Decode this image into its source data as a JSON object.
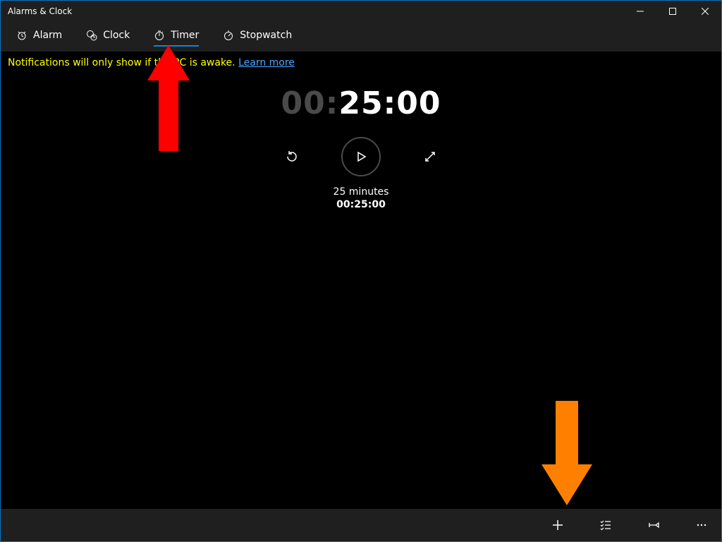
{
  "window": {
    "title": "Alarms & Clock"
  },
  "tabs": [
    {
      "label": "Alarm"
    },
    {
      "label": "Clock"
    },
    {
      "label": "Timer"
    },
    {
      "label": "Stopwatch"
    }
  ],
  "notice": {
    "text": "Notifications will only show if the PC is awake.",
    "link": "Learn more"
  },
  "timer": {
    "display": {
      "dim_prefix": "00",
      "dim_colon": ":",
      "bright": "25:00"
    },
    "name": "25 minutes",
    "remaining": "00:25:00"
  },
  "commands": {
    "add": "+",
    "select": "select",
    "pin": "pin",
    "more": "more"
  },
  "annotations": {
    "arrow1_color": "#ff0000",
    "arrow2_color": "#ff8000"
  }
}
